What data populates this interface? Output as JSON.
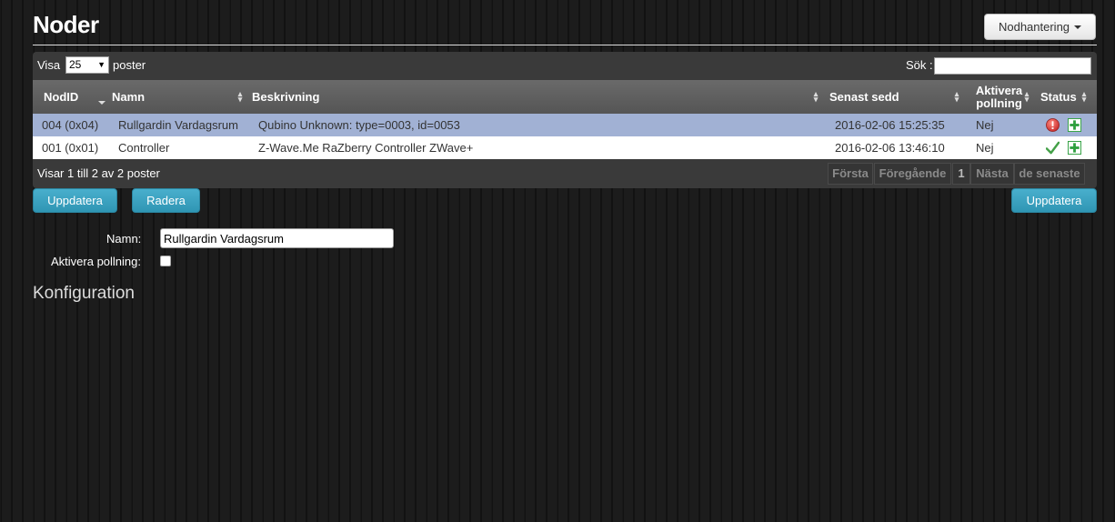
{
  "header": {
    "title": "Noder",
    "menu_label": "Nodhantering"
  },
  "table_controls": {
    "show_label": "Visa",
    "page_length": "25",
    "entries_label": "poster",
    "search_label": "Sök :",
    "search_value": ""
  },
  "columns": [
    "NodID",
    "Namn",
    "Beskrivning",
    "Senast sedd",
    "Aktivera pollning",
    "Status"
  ],
  "rows": [
    {
      "nodeid": "004 (0x04)",
      "name": "Rullgardin Vardagsrum",
      "description": "Qubino Unknown: type=0003, id=0053",
      "last_seen": "2016-02-06 15:25:35",
      "polling": "Nej",
      "status_icon": "error-icon",
      "selected": true
    },
    {
      "nodeid": "001 (0x01)",
      "name": "Controller",
      "description": "Z-Wave.Me RaZberry Controller ZWave+",
      "last_seen": "2016-02-06 13:46:10",
      "polling": "Nej",
      "status_icon": "check-icon",
      "selected": false
    }
  ],
  "footer": {
    "info": "Visar 1 till 2 av 2 poster",
    "pagination": {
      "first": "Första",
      "previous": "Föregående",
      "page": "1",
      "next": "Nästa",
      "last": "de senaste"
    }
  },
  "actions": {
    "update_left": "Uppdatera",
    "delete": "Radera",
    "update_right": "Uppdatera"
  },
  "form": {
    "name_label": "Namn:",
    "name_value": "Rullgardin Vardagsrum",
    "polling_label": "Aktivera pollning:",
    "polling_checked": false
  },
  "config_heading": "Konfiguration",
  "colors": {
    "selected_row": "#a1b1d4",
    "button_blue": "#2f96b4",
    "error_red": "#d9302c",
    "add_green": "#2e9f3e"
  }
}
